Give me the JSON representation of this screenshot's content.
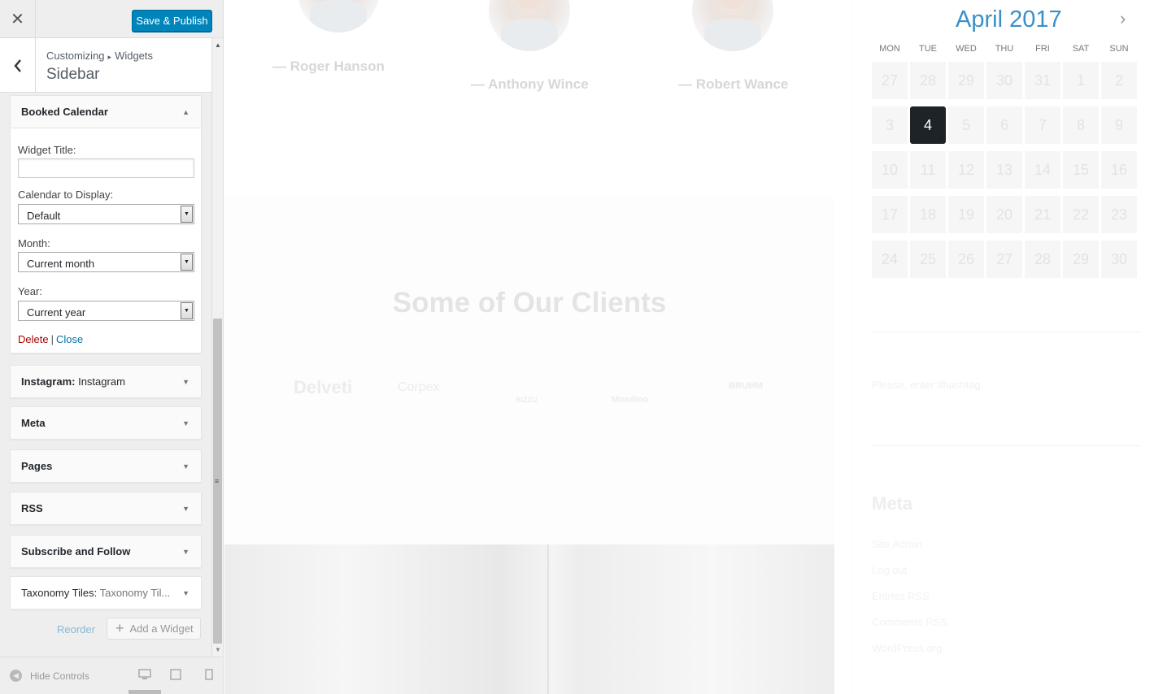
{
  "customizer": {
    "close_icon": "close-icon",
    "publish_label": "Save & Publish",
    "breadcrumb": {
      "root": "Customizing",
      "current": "Widgets"
    },
    "section_title": "Sidebar",
    "booked_widget": {
      "title": "Booked Calendar",
      "fields": {
        "widget_title_label": "Widget Title:",
        "widget_title_value": "",
        "calendar_label": "Calendar to Display:",
        "calendar_value": "Default",
        "month_label": "Month:",
        "month_value": "Current month",
        "year_label": "Year:",
        "year_value": "Current year"
      },
      "delete_label": "Delete",
      "separator": "|",
      "close_label": "Close"
    },
    "widgets": [
      {
        "name": "Instagram:",
        "subtitle": "Instagram"
      },
      {
        "name": "Meta",
        "subtitle": ""
      },
      {
        "name": "Pages",
        "subtitle": ""
      },
      {
        "name": "RSS",
        "subtitle": ""
      },
      {
        "name": "Subscribe and Follow",
        "subtitle": ""
      },
      {
        "name": "Taxonomy Tiles:",
        "subtitle": "Taxonomy Til..."
      }
    ],
    "reorder_label": "Reorder",
    "add_widget_label": "Add a Widget",
    "hide_controls_label": "Hide Controls"
  },
  "preview": {
    "team": [
      "— Roger Hanson",
      "— Anthony Wince",
      "— Robert Wance"
    ],
    "clients_title": "Some of Our Clients",
    "client_logos": [
      "Delveti",
      "Corpex",
      "BIZZU",
      "Moxdino",
      "BRUMM"
    ],
    "calendar": {
      "title": "April 2017",
      "weekdays": [
        "MON",
        "TUE",
        "WED",
        "THU",
        "FRI",
        "SAT",
        "SUN"
      ],
      "days": [
        "27",
        "28",
        "29",
        "30",
        "31",
        "1",
        "2",
        "3",
        "4",
        "5",
        "6",
        "7",
        "8",
        "9",
        "10",
        "11",
        "12",
        "13",
        "14",
        "15",
        "16",
        "17",
        "18",
        "19",
        "20",
        "21",
        "22",
        "23",
        "24",
        "25",
        "26",
        "27",
        "28",
        "29",
        "30"
      ],
      "selected_day": "4"
    },
    "hashtag_placeholder": "Please, enter #hashtag.",
    "meta_title": "Meta",
    "meta_links": [
      "Site Admin",
      "Log out",
      "Entries RSS",
      "Comments RSS",
      "WordPress.org"
    ]
  }
}
